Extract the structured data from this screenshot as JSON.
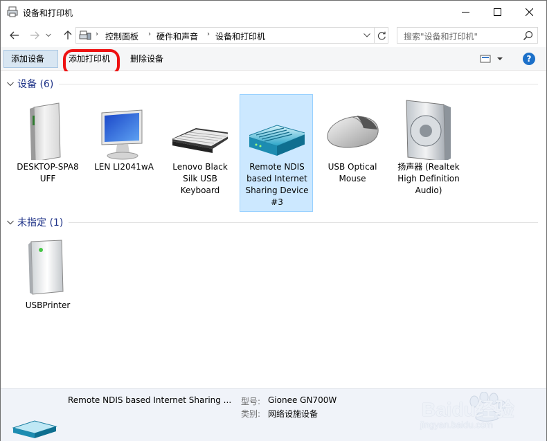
{
  "window": {
    "title": "设备和打印机",
    "controls": {
      "minimize": "minimize",
      "maximize": "maximize",
      "close": "close"
    }
  },
  "address": {
    "breadcrumbs": [
      "控制面板",
      "硬件和声音",
      "设备和打印机"
    ],
    "search_placeholder": "搜索\"设备和打印机\""
  },
  "commands": {
    "add_device": "添加设备",
    "add_printer": "添加打印机",
    "remove_device": "删除设备",
    "help": "?"
  },
  "groups": [
    {
      "title": "设备 (6)",
      "items": [
        {
          "label": "DESKTOP-SPA8\nUFF",
          "icon": "computer-tower-icon"
        },
        {
          "label": "LEN LI2041wA",
          "icon": "monitor-icon"
        },
        {
          "label": "Lenovo Black\nSilk USB\nKeyboard",
          "icon": "keyboard-icon"
        },
        {
          "label": "Remote NDIS\nbased Internet\nSharing Device\n#3",
          "icon": "network-device-icon",
          "selected": true
        },
        {
          "label": "USB Optical\nMouse",
          "icon": "mouse-icon"
        },
        {
          "label": "扬声器 (Realtek\nHigh Definition\nAudio)",
          "icon": "speaker-icon"
        }
      ]
    },
    {
      "title": "未指定 (1)",
      "items": [
        {
          "label": "USBPrinter",
          "icon": "printer-box-icon"
        }
      ]
    }
  ],
  "details": {
    "name": "Remote NDIS based Internet Sharing ...",
    "model_label": "型号:",
    "model_value": "Gionee GN700W",
    "category_label": "类别:",
    "category_value": "网络设施设备"
  },
  "watermark": {
    "brand": "Baidu经验",
    "url": "jingyan.baidu.com"
  },
  "colors": {
    "accent": "#1c70c9",
    "selection": "#cce8ff",
    "group_title": "#1e3287",
    "annotation": "#e11111"
  }
}
